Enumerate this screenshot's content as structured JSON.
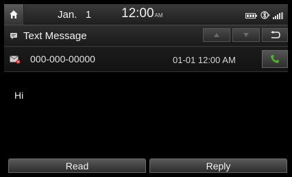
{
  "status_bar": {
    "home_icon": "home-icon",
    "date": "Jan.   1",
    "time": "12:00",
    "ampm": "AM",
    "icons": [
      "battery-icon",
      "bluetooth-icon",
      "signal-icon"
    ]
  },
  "title_bar": {
    "icon": "message-icon",
    "title": "Text Message",
    "nav_up_icon": "arrow-up-icon",
    "nav_down_icon": "arrow-down-icon",
    "back_icon": "back-icon"
  },
  "message": {
    "sender_icon": "message-received-icon",
    "sender_number": "000-000-00000",
    "datetime": "01-01 12:00 AM",
    "call_icon": "phone-icon",
    "body": "Hi"
  },
  "actions": {
    "read_label": "Read",
    "reply_label": "Reply"
  },
  "colors": {
    "call_icon": "#4caf2a"
  }
}
